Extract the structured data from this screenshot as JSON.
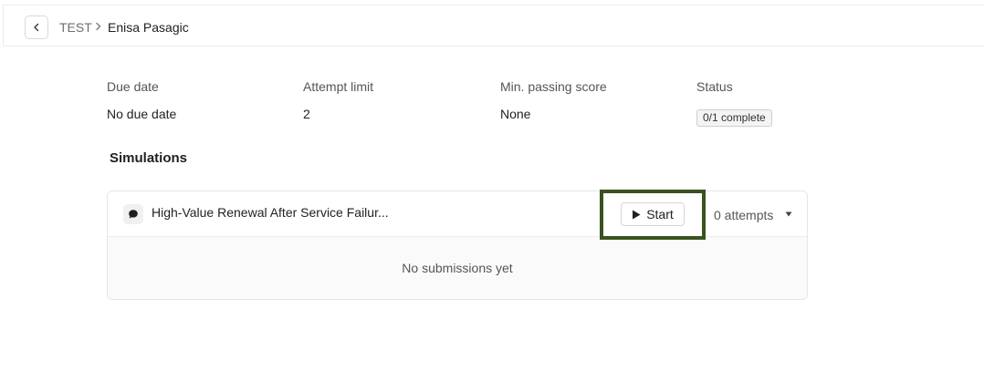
{
  "breadcrumb": {
    "root": "TEST",
    "current": "Enisa Pasagic"
  },
  "meta": {
    "due_date": {
      "label": "Due date",
      "value": "No due date"
    },
    "attempt_limit": {
      "label": "Attempt limit",
      "value": "2"
    },
    "min_passing_score": {
      "label": "Min. passing score",
      "value": "None"
    },
    "status": {
      "label": "Status",
      "value": "0/1 complete"
    }
  },
  "simulations": {
    "title": "Simulations",
    "items": [
      {
        "title": "High-Value Renewal After Service Failur...",
        "start_label": "Start",
        "attempts_label": "0 attempts",
        "empty_message": "No submissions yet"
      }
    ]
  },
  "colors": {
    "highlight": "#3a5220"
  }
}
